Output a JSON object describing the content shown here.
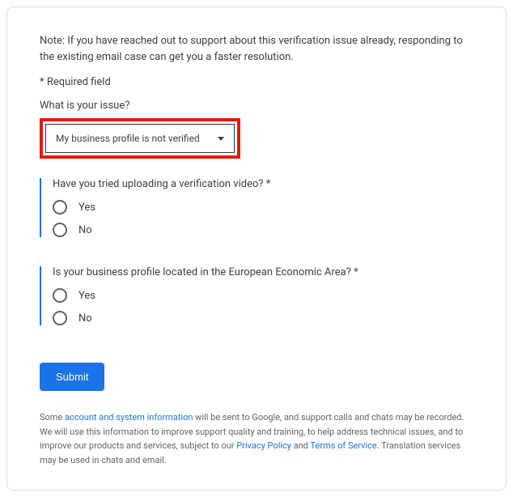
{
  "note": "Note: If you have reached out to support about this verification issue already, responding to the existing email case can get you a faster resolution.",
  "required_field": "* Required field",
  "issue_label": "What is your issue?",
  "dropdown": {
    "selected": "My business profile is not verified"
  },
  "question1": {
    "text": "Have you tried uploading a verification video? *",
    "options": {
      "yes": "Yes",
      "no": "No"
    }
  },
  "question2": {
    "text": "Is your business profile located in the European Economic Area? *",
    "options": {
      "yes": "Yes",
      "no": "No"
    }
  },
  "submit_label": "Submit",
  "disclaimer": {
    "text1": "Some ",
    "link1": "account and system information",
    "text2": " will be sent to Google, and support calls and chats may be recorded. We will use this information to improve support quality and training, to help address technical issues, and to improve our products and services, subject to our ",
    "link2": "Privacy Policy",
    "text3": " and ",
    "link3": "Terms of Service",
    "text4": ". Translation services may be used in chats and email."
  }
}
